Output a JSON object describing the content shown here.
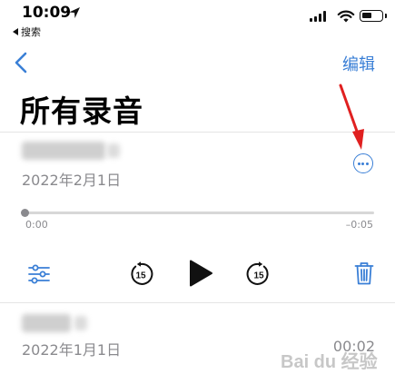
{
  "status_bar": {
    "time": "10:09",
    "back_app_label": "搜索"
  },
  "nav": {
    "edit_label": "编辑"
  },
  "page": {
    "title": "所有录音"
  },
  "recordings": [
    {
      "name": "",
      "date": "2022年2月1日",
      "expanded": true,
      "elapsed": "0:00",
      "remaining": "–0:05",
      "progress": 0
    },
    {
      "name": "",
      "date": "2022年1月1日",
      "duration": "00:02"
    }
  ],
  "controls": {
    "skip_seconds": "15"
  },
  "watermark": {
    "text": "Bai du 经验"
  },
  "colors": {
    "accent": "#3a7fd6",
    "annotation_arrow": "#e02020",
    "secondary_text": "#8a8a8e"
  },
  "icons": [
    "location-arrow-icon",
    "cellular-signal-icon",
    "wifi-icon",
    "battery-icon",
    "chevron-left-icon",
    "ellipsis-circle-icon",
    "sliders-icon",
    "skip-back-15-icon",
    "play-icon",
    "skip-forward-15-icon",
    "trash-icon",
    "red-arrow-annotation"
  ]
}
